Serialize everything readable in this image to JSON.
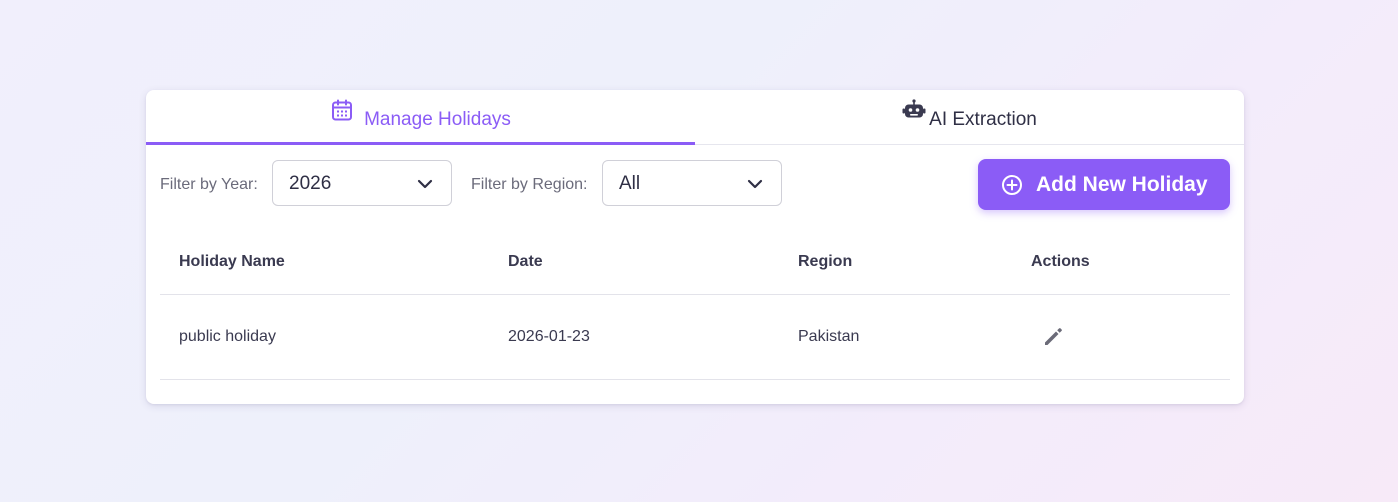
{
  "tabs": [
    {
      "label": "Manage Holidays",
      "icon": "calendar-icon",
      "active": true
    },
    {
      "label": "AI Extraction",
      "icon": "robot-icon",
      "active": false
    }
  ],
  "filters": {
    "year_label": "Filter by Year:",
    "year_value": "2026",
    "region_label": "Filter by Region:",
    "region_value": "All"
  },
  "add_button": {
    "label": "Add New Holiday",
    "icon": "plus-circle-icon"
  },
  "table": {
    "headers": [
      "Holiday Name",
      "Date",
      "Region",
      "Actions"
    ],
    "rows": [
      {
        "name": "public holiday",
        "date": "2026-01-23",
        "region": "Pakistan",
        "action_icon": "pencil-icon"
      }
    ]
  },
  "colors": {
    "accent": "#8b5cf6",
    "text": "#2f2f45",
    "muted": "#6b6b7b",
    "border": "#e3e3ea"
  }
}
